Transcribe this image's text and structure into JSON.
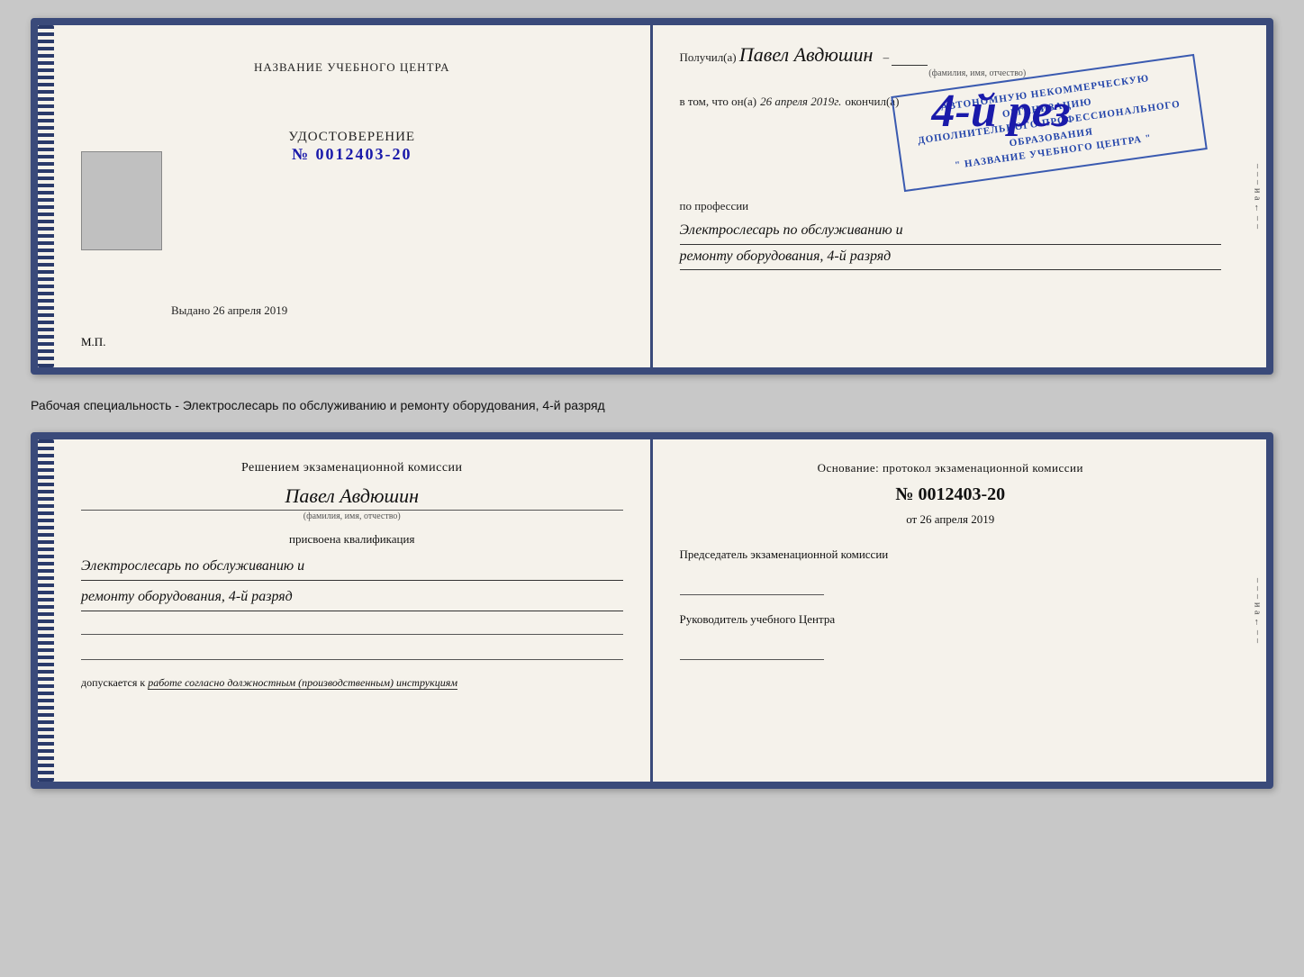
{
  "top_document": {
    "left_page": {
      "center_title": "НАЗВАНИЕ УЧЕБНОГО ЦЕНТРА",
      "udostoverenie_label": "УДОСТОВЕРЕНИЕ",
      "udostoverenie_number": "№ 0012403-20",
      "vydano_prefix": "Выдано",
      "vydano_date": "26 апреля 2019",
      "mp_label": "М.П."
    },
    "right_page": {
      "received_prefix": "Получил(а)",
      "received_name": "Павел Авдюшин",
      "fio_hint": "(фамилия, имя, отчество)",
      "vtom_prefix": "в том, что он(а)",
      "vtom_date": "26 апреля 2019г.",
      "okончил_label": "окончил(а)",
      "stamp_line1": "АВТОНОМНУЮ НЕКОММЕРЧЕСКУЮ ОРГАНИЗАЦИЮ",
      "stamp_line2": "ДОПОЛНИТЕЛЬНОГО ПРОФЕССИОНАЛЬНОГО ОБРАЗОВАНИЯ",
      "stamp_line3": "\" НАЗВАНИЕ УЧЕБНОГО ЦЕНТРА \"",
      "big_4th": "4-й рез",
      "po_professii_label": "по профессии",
      "profession_line1": "Электрослесарь по обслуживанию и",
      "profession_line2": "ремонту оборудования, 4-й разряд"
    }
  },
  "between_caption": "Рабочая специальность - Электрослесарь по обслуживанию и ремонту оборудования, 4-й разряд",
  "bottom_document": {
    "left_page": {
      "resheniem_title": "Решением экзаменационной комиссии",
      "person_name": "Павел Авдюшин",
      "fio_hint": "(фамилия, имя, отчество)",
      "prisvoyena_label": "присвоена квалификация",
      "qualification_line1": "Электрослесарь по обслуживанию и",
      "qualification_line2": "ремонту оборудования, 4-й разряд",
      "dopuskaetsya_prefix": "допускается к",
      "dopuskaetsya_value": "работе согласно должностным (производственным) инструкциям"
    },
    "right_page": {
      "osnovanie_label": "Основание: протокол экзаменационной комиссии",
      "protocol_number": "№ 0012403-20",
      "ot_prefix": "от",
      "ot_date": "26 апреля 2019",
      "predsedatel_label": "Председатель экзаменационной комиссии",
      "rukovoditel_label": "Руководитель учебного Центра"
    }
  },
  "edge_chars": [
    "и",
    "а",
    "←",
    "–",
    "–",
    "–",
    "–"
  ],
  "colors": {
    "border": "#3a4a7a",
    "stamp": "#2244aa",
    "number_blue": "#1a1aaa",
    "background": "#f5f2eb"
  }
}
